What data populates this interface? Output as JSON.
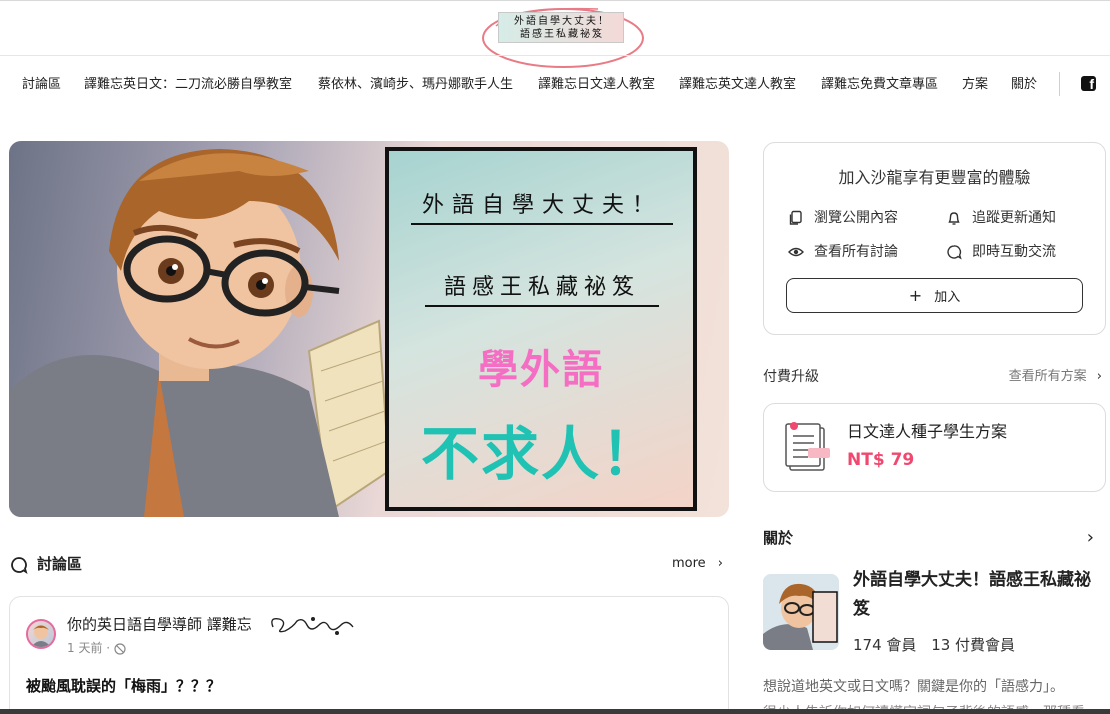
{
  "logo": {
    "line1": "外語自學大丈夫！",
    "line2": "語感王私藏祕笈"
  },
  "nav": {
    "items": [
      "討論區",
      "譯難忘英日文：二刀流必勝自學教室",
      "蔡依林、濱崎步、瑪丹娜歌手人生",
      "譯難忘日文達人教室",
      "譯難忘英文達人教室",
      "譯難忘免費文章專區",
      "方案",
      "關於"
    ],
    "social_icon": "facebook-icon"
  },
  "hero": {
    "line1": "外語自學大丈夫！",
    "line2": "語感王私藏祕笈",
    "line3": "學外語",
    "line4": "不求人！",
    "colors": {
      "line3": "#f46fc4",
      "line4": "#1fc2b3"
    }
  },
  "discussion": {
    "title": "討論區",
    "more": "more",
    "post": {
      "author": "你的英日語自學導師 譯難忘",
      "time": "1 天前",
      "title": "被颱風耽誤的「梅雨」？？？"
    }
  },
  "join": {
    "title": "加入沙龍享有更豐富的體驗",
    "features": [
      "瀏覽公開內容",
      "追蹤更新通知",
      "查看所有討論",
      "即時互動交流"
    ],
    "button": "加入"
  },
  "upgrade": {
    "title": "付費升級",
    "all_plans": "查看所有方案",
    "plan_name": "日文達人種子學生方案",
    "plan_price": "NT$ 79",
    "accent": "#f0486f"
  },
  "about": {
    "title": "關於",
    "name": "外語自學大丈夫！語感王私藏祕笈",
    "members": "174 會員",
    "paid_members": "13 付費會員",
    "description": "想說道地英文或日文嗎？關鍵是你的「語感力」。",
    "description_cont": "很少人告訴你如何讀懂字詞句子背後的語感，那種看"
  }
}
